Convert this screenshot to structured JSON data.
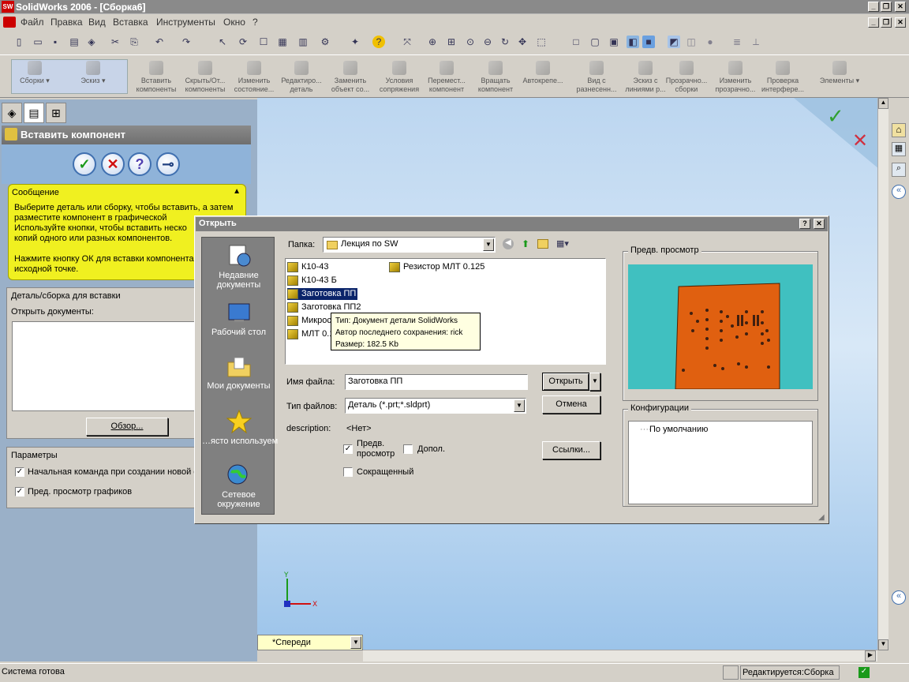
{
  "window": {
    "title": "SolidWorks 2006 - [Сборка6]",
    "logo": "SW"
  },
  "menu": [
    "Файл",
    "Правка",
    "Вид",
    "Вставка",
    "Инструменты",
    "Окно",
    "?"
  ],
  "commands": [
    {
      "label": "Сборки"
    },
    {
      "label": "Эскиз"
    },
    {
      "label": "Вставить компоненты"
    },
    {
      "label": "Скрыть/От... компоненты"
    },
    {
      "label": "Изменить состояние..."
    },
    {
      "label": "Редактиро... деталь"
    },
    {
      "label": "Заменить объект со..."
    },
    {
      "label": "Условия сопряжения"
    },
    {
      "label": "Перемест... компонент"
    },
    {
      "label": "Вращать компонент"
    },
    {
      "label": "Автокрепе..."
    },
    {
      "label": "Вид с разнесенн..."
    },
    {
      "label": "Эскиз с линиями р..."
    },
    {
      "label": "Прозрачно... сборки"
    },
    {
      "label": "Изменить прозрачно..."
    },
    {
      "label": "Проверка интерфере..."
    },
    {
      "label": "Элементы"
    }
  ],
  "property_manager": {
    "title": "Вставить компонент",
    "message_header": "Сообщение",
    "message": "Выберите деталь или сборку, чтобы вставить, а затем разместите компонент в графической\nИспользуйте кнопки, чтобы вставить неско\nкопий одного или разных компонентов.\n\nНажмите кнопку ОК для вставки компонента\nисходной точке.",
    "part_group": "Деталь/сборка для вставки",
    "open_docs_label": "Открыть документы:",
    "browse": "Обзор...",
    "params_group": "Параметры",
    "opt1": "Начальная команда при создании новой с",
    "opt2": "Пред. просмотр графиков"
  },
  "view": {
    "orientation": "*Спереди",
    "axis_x": "X",
    "axis_y": "Y"
  },
  "status": {
    "left": "Система готова",
    "right": "Редактируется:Сборка"
  },
  "dialog": {
    "title": "Открыть",
    "folder_label": "Папка:",
    "folder_value": "Лекция по SW",
    "places": [
      "Недавние документы",
      "Рабочий стол",
      "Мои документы",
      "…ясто используем",
      "Сетевое окружение"
    ],
    "files": [
      "К10-43",
      "К10-43 Б",
      "Заготовка ПП",
      "Заготовка ПП2",
      "Микрос",
      "МЛТ 0.1",
      "Резистор МЛТ 0.125"
    ],
    "tooltip": [
      "Тип: Документ детали SolidWorks",
      "Автор последнего сохранения: rick",
      "Размер: 182.5 Kb"
    ],
    "filename_label": "Имя файла:",
    "filename_value": "Заготовка ПП",
    "filetype_label": "Тип файлов:",
    "filetype_value": "Деталь (*.prt;*.sldprt)",
    "description_label": "description:",
    "description_value": "<Нет>",
    "preview_check": "Предв. просмотр",
    "extra_check": "Допол.",
    "short_check": "Сокращенный",
    "open_btn": "Открыть",
    "cancel_btn": "Отмена",
    "links_btn": "Ссылки...",
    "preview_group": "Предв. просмотр",
    "config_group": "Конфигурации",
    "config_default": "По умолчанию",
    "help_btn": "?",
    "close_btn": "✕"
  },
  "colors": {
    "accent_blue": "#0a246a",
    "board_orange": "#e06010",
    "preview_bg": "#40c0c0",
    "message_yellow": "#f0f020"
  }
}
